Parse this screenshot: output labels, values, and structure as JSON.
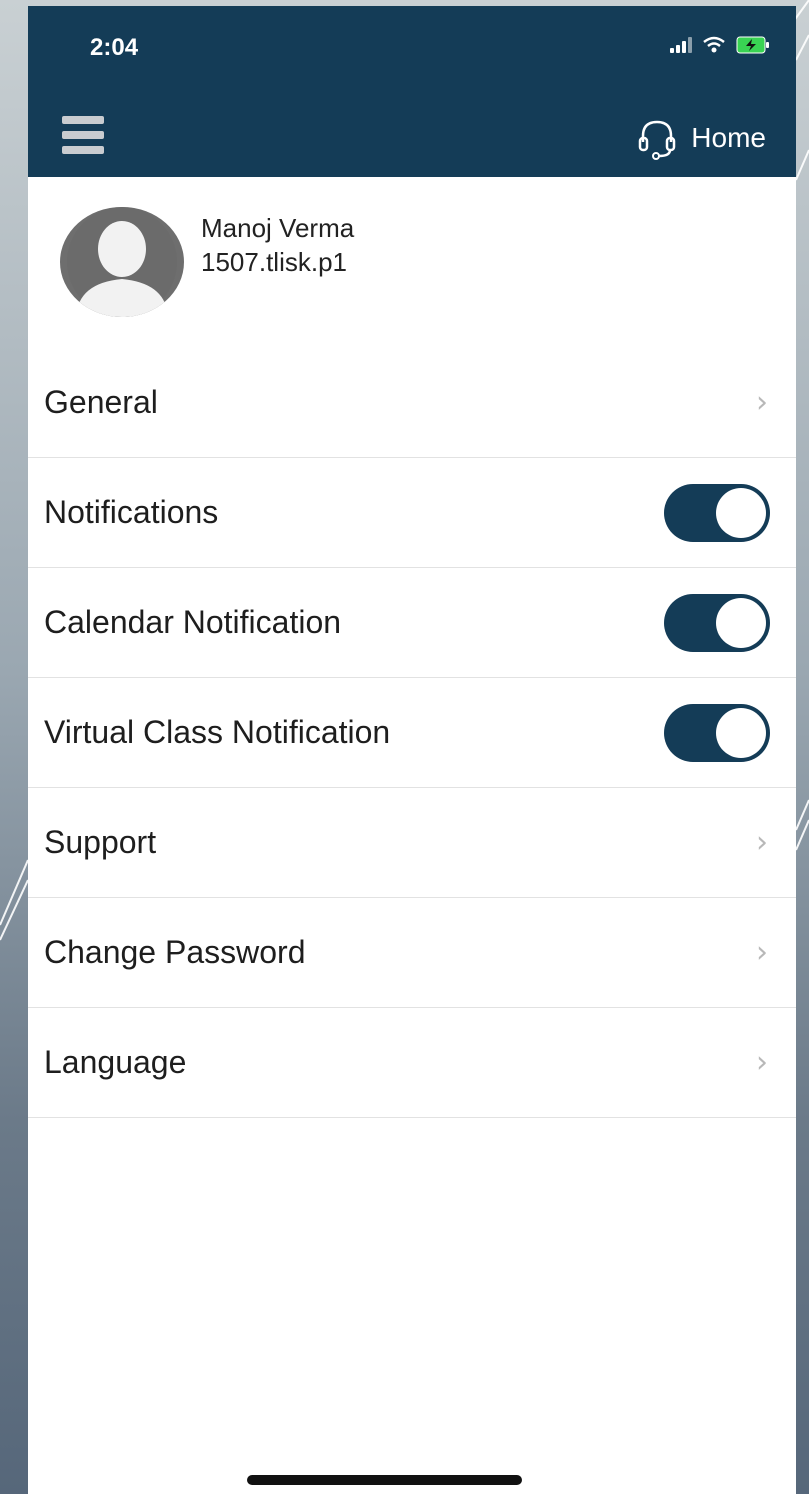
{
  "status_bar": {
    "time": "2:04"
  },
  "header": {
    "home_label": "Home"
  },
  "profile": {
    "name": "Manoj Verma",
    "user_id": "1507.tlisk.p1"
  },
  "settings": [
    {
      "label": "General",
      "control": "chevron"
    },
    {
      "label": "Notifications",
      "control": "toggle",
      "on": true
    },
    {
      "label": "Calendar Notification",
      "control": "toggle",
      "on": true
    },
    {
      "label": "Virtual Class Notification",
      "control": "toggle",
      "on": true
    },
    {
      "label": "Support",
      "control": "chevron"
    },
    {
      "label": "Change Password",
      "control": "chevron"
    },
    {
      "label": "Language",
      "control": "chevron"
    }
  ],
  "colors": {
    "header_bg": "#143c57",
    "toggle_on": "#143c57",
    "battery": "#39d353"
  },
  "icons": {
    "chevron": "›"
  }
}
